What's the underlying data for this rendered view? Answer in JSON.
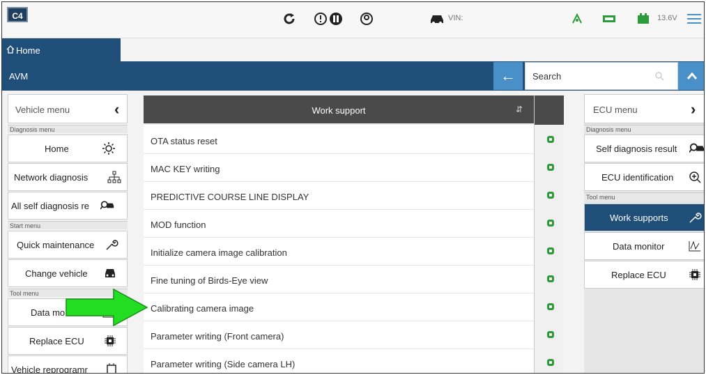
{
  "topbar": {
    "logo": "C4",
    "vin_label": "VIN:",
    "voltage": "13.6V"
  },
  "tab": {
    "home_label": "Home"
  },
  "avm_bar": {
    "title": "AVM",
    "search_label": "Search"
  },
  "left_panel": {
    "header": "Vehicle menu",
    "sections": {
      "diagnosis": "Diagnosis menu",
      "start": "Start menu",
      "tool": "Tool menu"
    },
    "items": [
      {
        "label": "Home",
        "icon": "gear-icon"
      },
      {
        "label": "Network diagnosis",
        "icon": "network-icon"
      },
      {
        "label": "All self diagnosis re",
        "icon": "car-search-icon"
      },
      {
        "label": "Quick maintenance",
        "icon": "wrench-icon"
      },
      {
        "label": "Change vehicle",
        "icon": "car-icon"
      },
      {
        "label": "Data mo",
        "icon": "data-monitor-icon"
      },
      {
        "label": "Replace ECU",
        "icon": "chip-icon"
      },
      {
        "label": "Vehicle reprogramr",
        "icon": "reprogram-icon"
      }
    ]
  },
  "center": {
    "header": "Work support",
    "rows": [
      "OTA status reset",
      "MAC KEY writing",
      "PREDICTIVE COURSE LINE DISPLAY",
      "MOD function",
      "Initialize camera image calibration",
      "Fine tuning of Birds-Eye view",
      "Calibrating camera image",
      "Parameter writing (Front camera)",
      "Parameter writing (Side camera LH)"
    ]
  },
  "right_panel": {
    "header": "ECU menu",
    "sections": {
      "diagnosis": "Diagnosis menu",
      "tool": "Tool menu"
    },
    "items": [
      {
        "label": "Self diagnosis result",
        "icon": "car-search-icon"
      },
      {
        "label": "ECU identification",
        "icon": "zoom-in-icon"
      },
      {
        "label": "Work supports",
        "icon": "wrench-icon",
        "active": true
      },
      {
        "label": "Data monitor",
        "icon": "data-monitor-icon"
      },
      {
        "label": "Replace ECU",
        "icon": "chip-icon"
      }
    ]
  },
  "colors": {
    "nav_blue": "#1f4e79",
    "accent_blue": "#4a90c8",
    "status_green": "#2a9d3a",
    "arrow_green": "#22dd22"
  }
}
